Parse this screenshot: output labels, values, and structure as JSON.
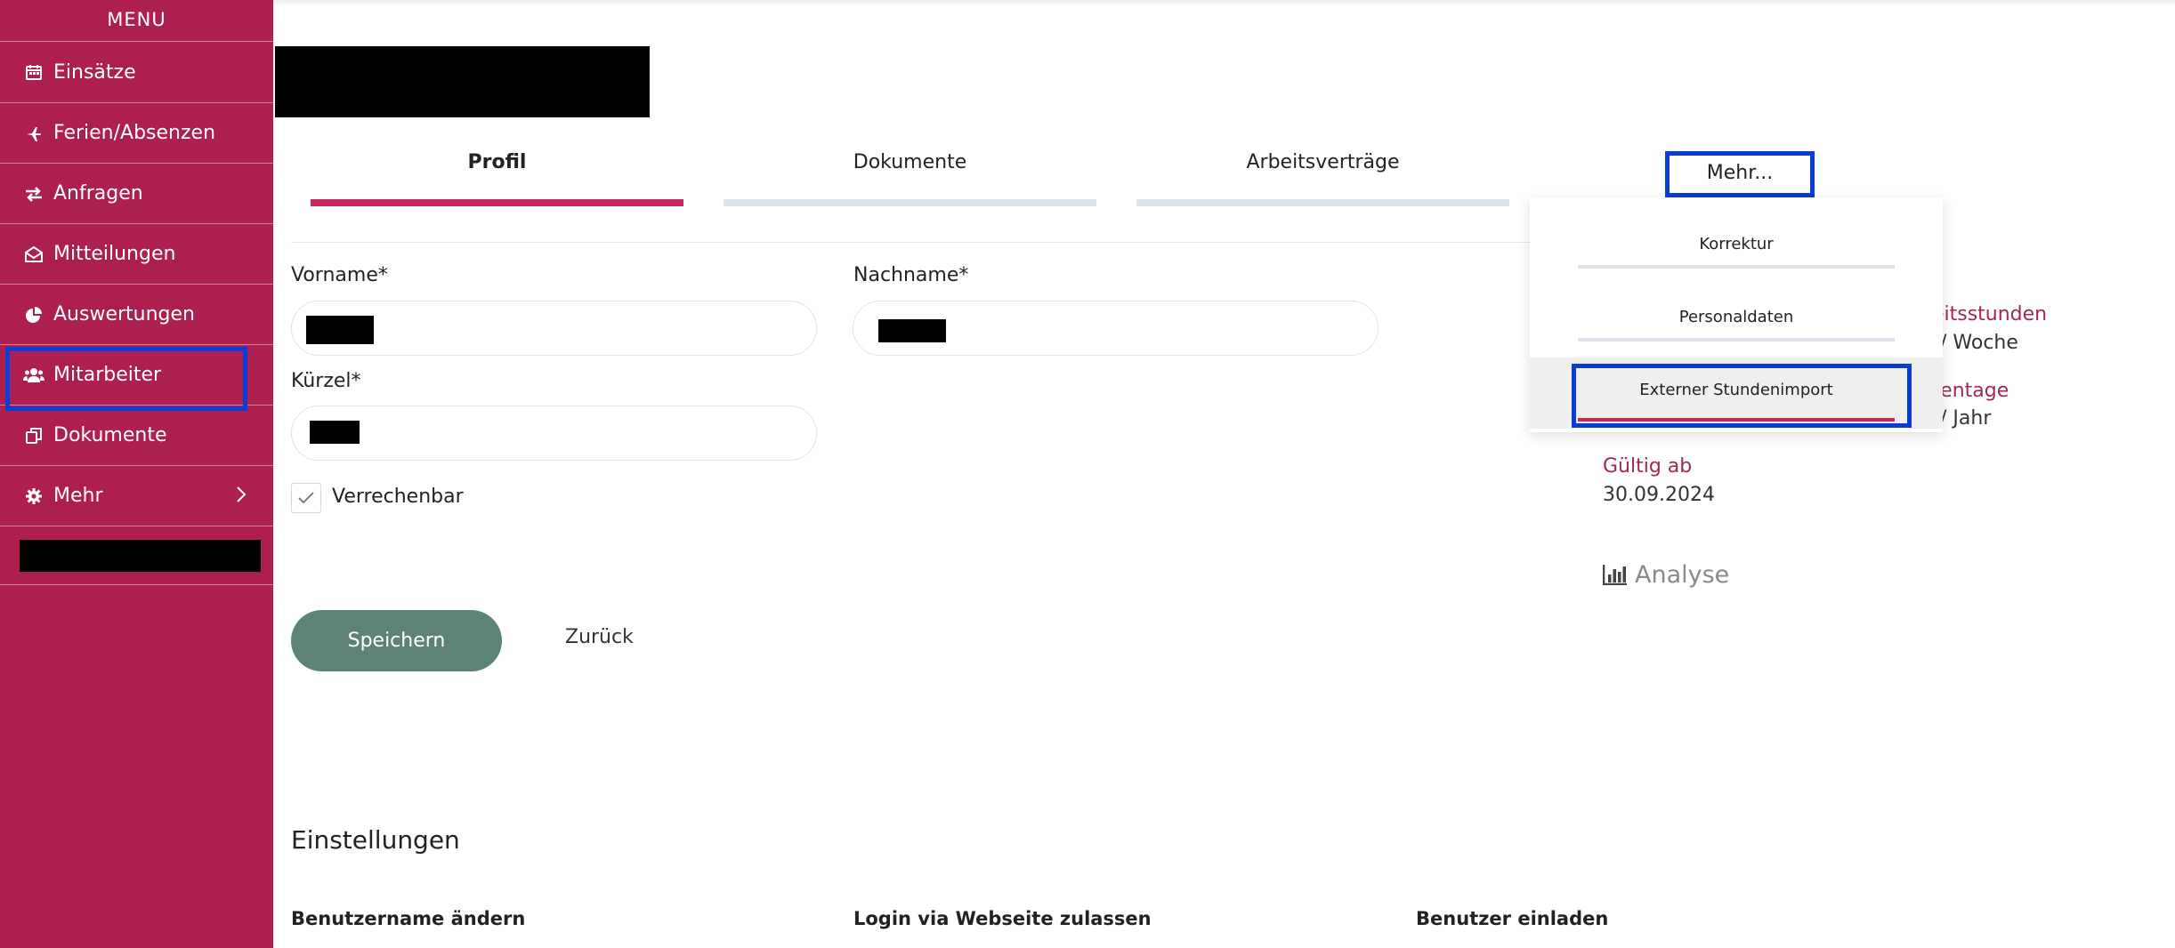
{
  "sidebar": {
    "title": "MENU",
    "items": [
      {
        "label": "Einsätze",
        "icon": "calendar-icon"
      },
      {
        "label": "Ferien/Absenzen",
        "icon": "plane-icon"
      },
      {
        "label": "Anfragen",
        "icon": "swap-arrows-icon"
      },
      {
        "label": "Mitteilungen",
        "icon": "envelope-open-icon"
      },
      {
        "label": "Auswertungen",
        "icon": "pie-chart-icon"
      },
      {
        "label": "Mitarbeiter",
        "icon": "users-icon"
      },
      {
        "label": "Dokumente",
        "icon": "copy-icon"
      },
      {
        "label": "Mehr",
        "icon": "gear-icon"
      }
    ]
  },
  "tabs": [
    {
      "label": "Profil"
    },
    {
      "label": "Dokumente"
    },
    {
      "label": "Arbeitsverträge"
    }
  ],
  "more_button": {
    "label": "Mehr..."
  },
  "dropdown": {
    "items": [
      {
        "label": "Korrektur"
      },
      {
        "label": "Personaldaten"
      },
      {
        "label": "Externer Stundenimport"
      }
    ]
  },
  "form": {
    "vorname_label": "Vorname*",
    "nachname_label": "Nachname*",
    "kuerzel_label": "Kürzel*",
    "verrechenbar_label": "Verrechenbar",
    "verrechenbar_checked": true
  },
  "buttons": {
    "save": "Speichern",
    "back": "Zurück"
  },
  "info": {
    "arbeitsstunden_label": "beitsstunden",
    "arbeitsstunden_value": "/ Woche",
    "ferientage_label": "rientage",
    "ferientage_value": "/ Jahr",
    "gueltig_label": "Gültig ab",
    "gueltig_value": "30.09.2024",
    "analyse_label": "Analyse"
  },
  "settings": {
    "title": "Einstellungen",
    "headings": [
      "Benutzername ändern",
      "Login via Webseite zulassen",
      "Benutzer einladen"
    ]
  },
  "colors": {
    "sidebar": "#ad1f4e",
    "accent": "#c7285e",
    "save_button": "#5d8378",
    "highlight": "#0a3cd6"
  }
}
